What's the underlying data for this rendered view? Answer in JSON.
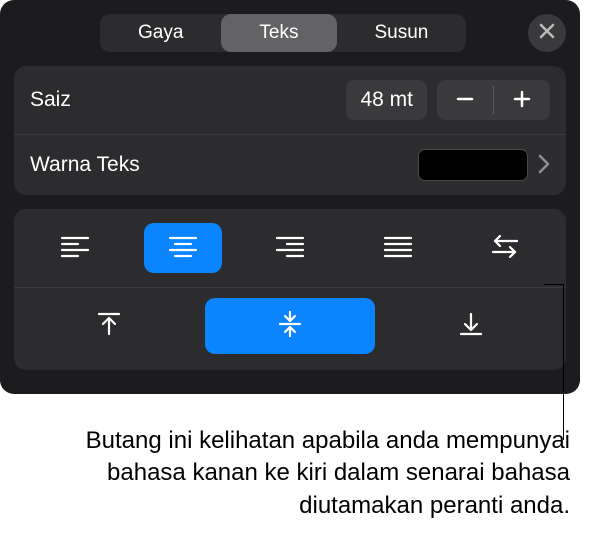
{
  "tabs": {
    "gaya": "Gaya",
    "teks": "Teks",
    "susun": "Susun"
  },
  "size": {
    "label": "Saiz",
    "value": "48 mt"
  },
  "textcolor": {
    "label": "Warna Teks",
    "swatch": "#000000"
  },
  "align": {
    "left": "align-left",
    "center": "align-center",
    "right": "align-right",
    "justify": "align-justify",
    "rtl": "text-direction-rtl"
  },
  "valign": {
    "top": "valign-top",
    "middle": "valign-middle",
    "bottom": "valign-bottom"
  },
  "caption": "Butang ini kelihatan apabila anda mempunyai bahasa kanan ke kiri dalam senarai bahasa diutamakan peranti anda."
}
